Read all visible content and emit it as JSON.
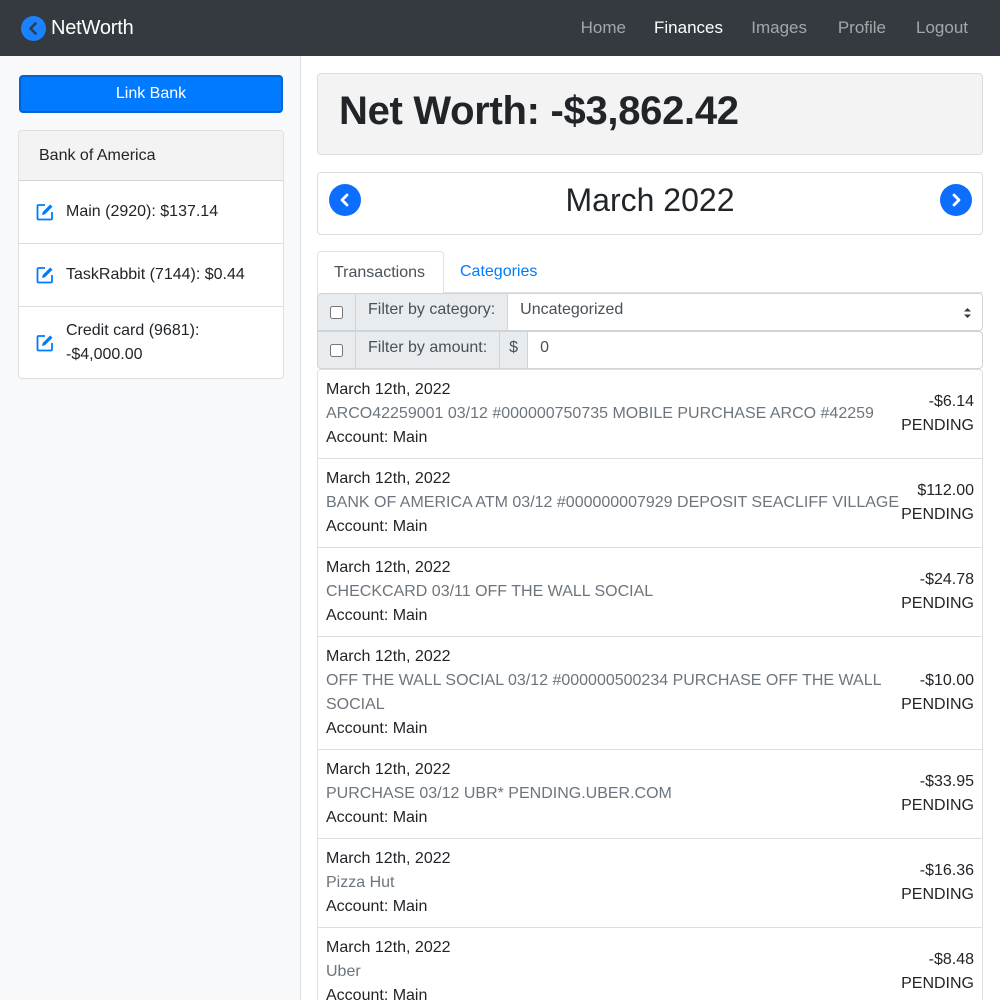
{
  "navbar": {
    "brand": "NetWorth",
    "items": [
      {
        "label": "Home",
        "active": false
      },
      {
        "label": "Finances",
        "active": true
      },
      {
        "label": "Images",
        "active": false
      },
      {
        "label": "Profile",
        "active": false
      },
      {
        "label": "Logout",
        "active": false
      }
    ]
  },
  "sidebar": {
    "link_bank_label": "Link Bank",
    "bank_name": "Bank of America",
    "accounts": [
      {
        "label": "Main (2920): $137.14"
      },
      {
        "label": "TaskRabbit (7144): $0.44"
      },
      {
        "label_line1": "Credit card (9681):",
        "label_line2": "-$4,000.00"
      }
    ]
  },
  "main": {
    "net_worth": "Net Worth: -$3,862.42",
    "month": "March 2022",
    "tabs": [
      {
        "label": "Transactions",
        "active": true
      },
      {
        "label": "Categories",
        "active": false
      }
    ],
    "filters": {
      "category_label": "Filter by category:",
      "category_value": "Uncategorized",
      "amount_label": "Filter by amount:",
      "currency_symbol": "$",
      "amount_value": "0"
    },
    "transactions": [
      {
        "date": "March 12th, 2022",
        "desc": "ARCO42259001 03/12 #000000750735 MOBILE PURCHASE ARCO #42259",
        "account": "Account: Main",
        "amount": "-$6.14",
        "status": "PENDING"
      },
      {
        "date": "March 12th, 2022",
        "desc": "BANK OF AMERICA ATM 03/12 #000000007929 DEPOSIT SEACLIFF VILLAGE",
        "account": "Account: Main",
        "amount": "$112.00",
        "status": "PENDING"
      },
      {
        "date": "March 12th, 2022",
        "desc": "CHECKCARD 03/11 OFF THE WALL SOCIAL",
        "account": "Account: Main",
        "amount": "-$24.78",
        "status": "PENDING"
      },
      {
        "date": "March 12th, 2022",
        "desc_line1": "OFF THE WALL SOCIAL 03/12 #000000500234 PURCHASE OFF THE WALL",
        "desc_line2": "SOCIAL",
        "account": "Account: Main",
        "amount": "-$10.00",
        "status": "PENDING"
      },
      {
        "date": "March 12th, 2022",
        "desc": "PURCHASE 03/12 UBR* PENDING.UBER.COM",
        "account": "Account: Main",
        "amount": "-$33.95",
        "status": "PENDING"
      },
      {
        "date": "March 12th, 2022",
        "desc": "Pizza Hut",
        "account": "Account: Main",
        "amount": "-$16.36",
        "status": "PENDING"
      },
      {
        "date": "March 12th, 2022",
        "desc": "Uber",
        "account": "Account: Main",
        "amount": "-$8.48",
        "status": "PENDING"
      }
    ]
  },
  "colors": {
    "navbar_bg": "#343a40",
    "primary": "#007bff",
    "brand_icon": "#1a82ff"
  },
  "icons": {
    "brand": "chevron-left-circle-icon",
    "edit": "edit-square-icon",
    "prev": "chevron-left-circle-icon",
    "next": "chevron-right-circle-icon",
    "select": "select-arrows-icon"
  }
}
